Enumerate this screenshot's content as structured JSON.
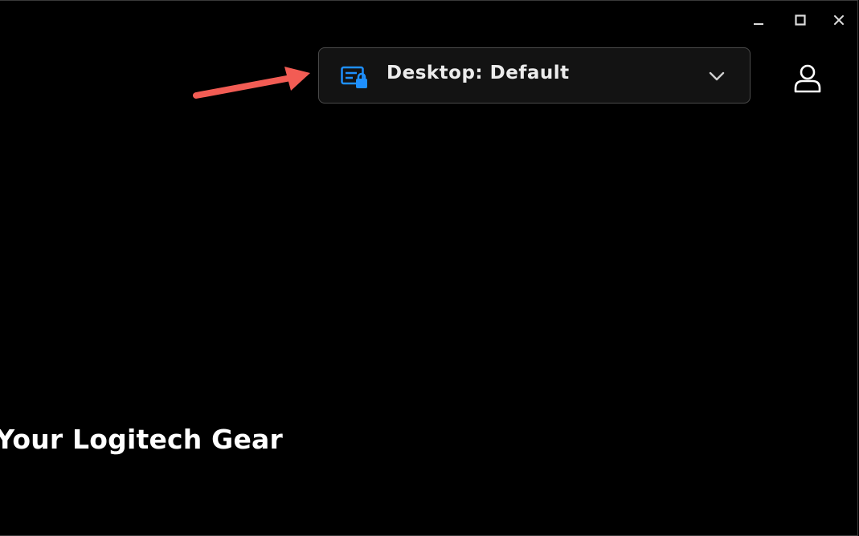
{
  "window_controls": {
    "minimize_icon": "minimize-icon",
    "maximize_icon": "maximize-icon",
    "close_icon": "close-icon"
  },
  "profile_selector": {
    "label": "Desktop: Default",
    "icon": "locked-profile-icon",
    "dropdown_icon": "chevron-down-icon",
    "icon_color": "#1e90ff"
  },
  "account": {
    "icon": "user-icon"
  },
  "annotation": {
    "icon": "arrow-right-icon",
    "color": "#f25c54"
  },
  "main": {
    "heading_visible": "t Your Logitech Gear"
  }
}
